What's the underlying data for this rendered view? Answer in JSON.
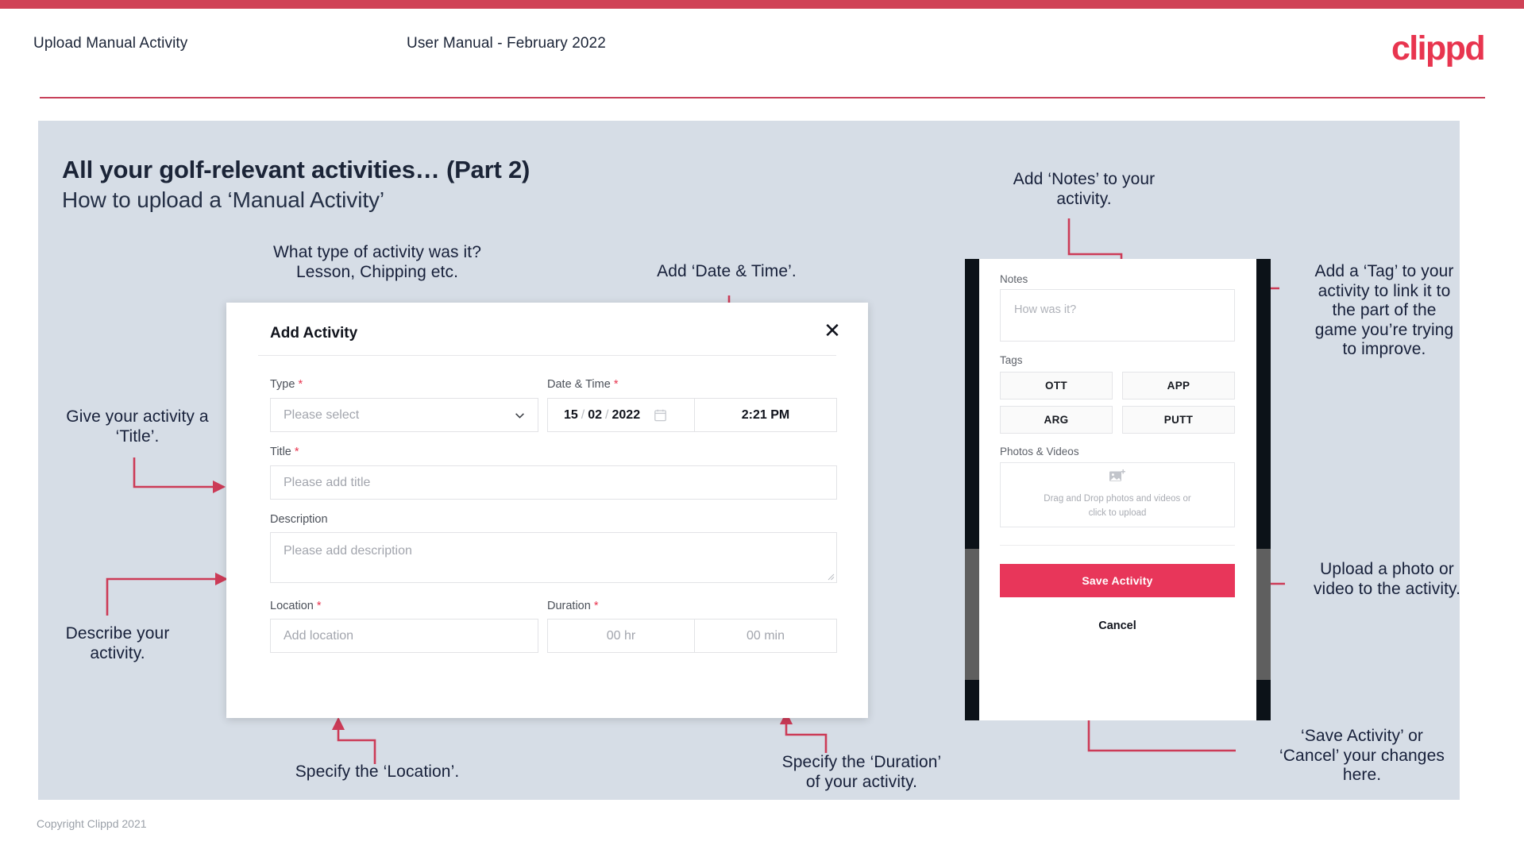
{
  "header": {
    "left_title": "Upload Manual Activity",
    "center_title": "User Manual - February 2022",
    "logo": "clippd"
  },
  "slide": {
    "heading": "All your golf-relevant activities… (Part 2)",
    "subheading": "How to upload a ‘Manual Activity’"
  },
  "annotations": {
    "type_note": "What type of activity was it?\nLesson, Chipping etc.",
    "datetime_note": "Add ‘Date & Time’.",
    "title_note": "Give your activity a\n‘Title’.",
    "description_note": "Describe your\nactivity.",
    "location_note": "Specify the ‘Location’.",
    "duration_note": "Specify the ‘Duration’\nof your activity.",
    "notes_note": "Add ‘Notes’ to your\nactivity.",
    "tag_note": "Add a ‘Tag’ to your\nactivity to link it to\nthe part of the\ngame you’re trying\nto improve.",
    "upload_note": "Upload a photo or\nvideo to the activity.",
    "save_note": "‘Save Activity’ or\n‘Cancel’ your changes\nhere."
  },
  "dialog": {
    "title": "Add Activity",
    "close_icon": "close-icon",
    "fields": {
      "type": {
        "label": "Type",
        "required": "*",
        "placeholder": "Please select",
        "chevron_icon": "chevron-down-icon"
      },
      "datetime": {
        "label": "Date & Time",
        "required": "*",
        "day": "15",
        "sep1": "/",
        "month": "02",
        "sep2": "/",
        "year": "2022",
        "calendar_icon": "calendar-icon",
        "time": "2:21 PM"
      },
      "title": {
        "label": "Title",
        "required": "*",
        "placeholder": "Please add title"
      },
      "description": {
        "label": "Description",
        "placeholder": "Please add description"
      },
      "location": {
        "label": "Location",
        "required": "*",
        "placeholder": "Add location"
      },
      "duration": {
        "label": "Duration",
        "required": "*",
        "hours_placeholder": "00 hr",
        "minutes_placeholder": "00 min"
      }
    }
  },
  "phone": {
    "notes": {
      "label": "Notes",
      "placeholder": "How was it?"
    },
    "tags": {
      "label": "Tags",
      "items": [
        "OTT",
        "APP",
        "ARG",
        "PUTT"
      ]
    },
    "media": {
      "label": "Photos & Videos",
      "icon": "add-image-icon",
      "text": "Drag and Drop photos and videos or\nclick to upload"
    },
    "save_label": "Save Activity",
    "cancel_label": "Cancel"
  },
  "footer": {
    "copyright": "Copyright Clippd 2021"
  },
  "colors": {
    "brand_red": "#e8354f",
    "accent_line": "#d04256",
    "slide_bg": "#d6dde6",
    "text_dark": "#17203a",
    "save_button": "#e8365a"
  }
}
